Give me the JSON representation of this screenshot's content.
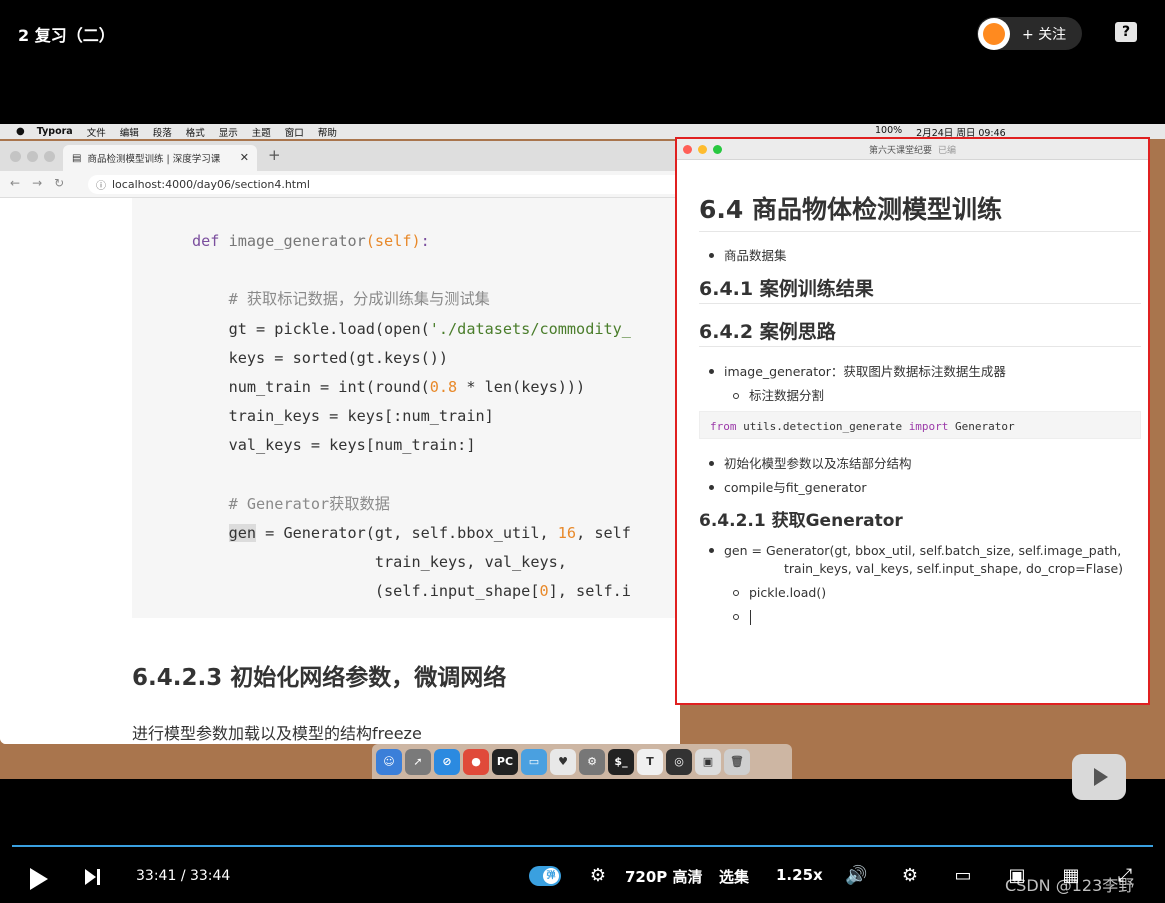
{
  "video": {
    "title": "2 复习（二）",
    "follow_label": "+ 关注",
    "help_label": "?"
  },
  "macos_menubar": {
    "apple": "",
    "items": [
      "Typora",
      "文件",
      "编辑",
      "段落",
      "格式",
      "显示",
      "主题",
      "窗口",
      "帮助"
    ],
    "status": [
      "100%",
      "2月24日 周日 09:46"
    ]
  },
  "browser": {
    "tab_title": "商品检测模型训练 | 深度学习课",
    "url": "localhost:4000/day06/section4.html",
    "code": {
      "def_kw": "def",
      "func": "image_generator",
      "self_param": "(self)",
      "colon": ":",
      "comment1": "# 获取标记数据，分成训练集与测试集",
      "l_gt_a": "gt = pickle.load(open(",
      "l_gt_str": "'./datasets/commodity_",
      "l_keys": "keys = sorted(gt.keys())",
      "l_num_a": "num_train = int(round(",
      "l_num_n": "0.8",
      "l_num_b": " * len(keys)))",
      "l_train": "train_keys = keys[:num_train]",
      "l_val": "val_keys = keys[num_train:]",
      "comment2": "# Generator获取数据",
      "l_gen_hl": "gen",
      "l_gen_a": " = Generator(gt, self.bbox_util, ",
      "l_gen_n": "16",
      "l_gen_b": ", self",
      "l_cont1": "train_keys, val_keys,",
      "l_cont2_a": "(self.input_shape[",
      "l_cont2_n": "0",
      "l_cont2_b": "], self.i"
    },
    "heading": "6.4.2.3 初始化网络参数，微调网络",
    "paragraph": "进行模型参数加载以及模型的结构freeze"
  },
  "typora": {
    "window_title": "第六天课堂纪要",
    "edited_label": "已编",
    "h1": "6.4 商品物体检测模型训练",
    "li_dataset": "商品数据集",
    "h2_results": "6.4.1 案例训练结果",
    "h2_approach": "6.4.2 案例思路",
    "li_image_generator": "image_generator：获取图片数据标注数据生成器",
    "li_split": "标注数据分割",
    "code_from": "from",
    "code_module": " utils.detection_generate ",
    "code_import": "import",
    "code_class": " Generator",
    "li_init": "初始化模型参数以及冻结部分结构",
    "li_compile": "compile与fit_generator",
    "h3_get": "6.4.2.1 获取Generator",
    "li_gen_line1": "gen = Generator(gt, bbox_util, self.batch_size, self.image_path,",
    "li_gen_line2": "train_keys, val_keys, self.input_shape, do_crop=Flase)",
    "li_pickle": "pickle.load()",
    "li_empty": ""
  },
  "dock": {
    "icons": [
      "finder-icon",
      "launchpad-icon",
      "safari-icon",
      "chrome-icon",
      "pycharm-icon",
      "keynote-icon",
      "vpn-icon",
      "preferences-icon",
      "terminal-icon",
      "typora-icon",
      "obs-icon",
      "screenshot-icon",
      "trash-icon"
    ]
  },
  "player": {
    "current_time": "33:41",
    "separator": "/",
    "total_time": "33:44",
    "danmaku_label": "弹",
    "quality": "720P 高清",
    "episodes": "选集",
    "speed": "1.25x",
    "watermark": "CSDN @123李野"
  },
  "colors": {
    "progress": "#3aa0e0",
    "highlight_border": "#e02020",
    "desktop": "#a9754d"
  }
}
